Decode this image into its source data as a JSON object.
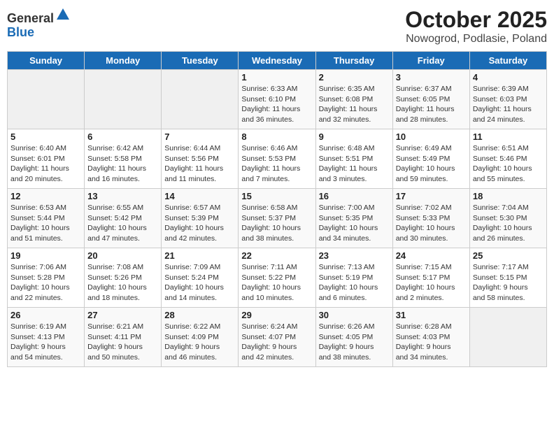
{
  "logo": {
    "general": "General",
    "blue": "Blue"
  },
  "title": {
    "month": "October 2025",
    "location": "Nowogrod, Podlasie, Poland"
  },
  "headers": [
    "Sunday",
    "Monday",
    "Tuesday",
    "Wednesday",
    "Thursday",
    "Friday",
    "Saturday"
  ],
  "weeks": [
    [
      {
        "day": "",
        "info": ""
      },
      {
        "day": "",
        "info": ""
      },
      {
        "day": "",
        "info": ""
      },
      {
        "day": "1",
        "info": "Sunrise: 6:33 AM\nSunset: 6:10 PM\nDaylight: 11 hours\nand 36 minutes."
      },
      {
        "day": "2",
        "info": "Sunrise: 6:35 AM\nSunset: 6:08 PM\nDaylight: 11 hours\nand 32 minutes."
      },
      {
        "day": "3",
        "info": "Sunrise: 6:37 AM\nSunset: 6:05 PM\nDaylight: 11 hours\nand 28 minutes."
      },
      {
        "day": "4",
        "info": "Sunrise: 6:39 AM\nSunset: 6:03 PM\nDaylight: 11 hours\nand 24 minutes."
      }
    ],
    [
      {
        "day": "5",
        "info": "Sunrise: 6:40 AM\nSunset: 6:01 PM\nDaylight: 11 hours\nand 20 minutes."
      },
      {
        "day": "6",
        "info": "Sunrise: 6:42 AM\nSunset: 5:58 PM\nDaylight: 11 hours\nand 16 minutes."
      },
      {
        "day": "7",
        "info": "Sunrise: 6:44 AM\nSunset: 5:56 PM\nDaylight: 11 hours\nand 11 minutes."
      },
      {
        "day": "8",
        "info": "Sunrise: 6:46 AM\nSunset: 5:53 PM\nDaylight: 11 hours\nand 7 minutes."
      },
      {
        "day": "9",
        "info": "Sunrise: 6:48 AM\nSunset: 5:51 PM\nDaylight: 11 hours\nand 3 minutes."
      },
      {
        "day": "10",
        "info": "Sunrise: 6:49 AM\nSunset: 5:49 PM\nDaylight: 10 hours\nand 59 minutes."
      },
      {
        "day": "11",
        "info": "Sunrise: 6:51 AM\nSunset: 5:46 PM\nDaylight: 10 hours\nand 55 minutes."
      }
    ],
    [
      {
        "day": "12",
        "info": "Sunrise: 6:53 AM\nSunset: 5:44 PM\nDaylight: 10 hours\nand 51 minutes."
      },
      {
        "day": "13",
        "info": "Sunrise: 6:55 AM\nSunset: 5:42 PM\nDaylight: 10 hours\nand 47 minutes."
      },
      {
        "day": "14",
        "info": "Sunrise: 6:57 AM\nSunset: 5:39 PM\nDaylight: 10 hours\nand 42 minutes."
      },
      {
        "day": "15",
        "info": "Sunrise: 6:58 AM\nSunset: 5:37 PM\nDaylight: 10 hours\nand 38 minutes."
      },
      {
        "day": "16",
        "info": "Sunrise: 7:00 AM\nSunset: 5:35 PM\nDaylight: 10 hours\nand 34 minutes."
      },
      {
        "day": "17",
        "info": "Sunrise: 7:02 AM\nSunset: 5:33 PM\nDaylight: 10 hours\nand 30 minutes."
      },
      {
        "day": "18",
        "info": "Sunrise: 7:04 AM\nSunset: 5:30 PM\nDaylight: 10 hours\nand 26 minutes."
      }
    ],
    [
      {
        "day": "19",
        "info": "Sunrise: 7:06 AM\nSunset: 5:28 PM\nDaylight: 10 hours\nand 22 minutes."
      },
      {
        "day": "20",
        "info": "Sunrise: 7:08 AM\nSunset: 5:26 PM\nDaylight: 10 hours\nand 18 minutes."
      },
      {
        "day": "21",
        "info": "Sunrise: 7:09 AM\nSunset: 5:24 PM\nDaylight: 10 hours\nand 14 minutes."
      },
      {
        "day": "22",
        "info": "Sunrise: 7:11 AM\nSunset: 5:22 PM\nDaylight: 10 hours\nand 10 minutes."
      },
      {
        "day": "23",
        "info": "Sunrise: 7:13 AM\nSunset: 5:19 PM\nDaylight: 10 hours\nand 6 minutes."
      },
      {
        "day": "24",
        "info": "Sunrise: 7:15 AM\nSunset: 5:17 PM\nDaylight: 10 hours\nand 2 minutes."
      },
      {
        "day": "25",
        "info": "Sunrise: 7:17 AM\nSunset: 5:15 PM\nDaylight: 9 hours\nand 58 minutes."
      }
    ],
    [
      {
        "day": "26",
        "info": "Sunrise: 6:19 AM\nSunset: 4:13 PM\nDaylight: 9 hours\nand 54 minutes."
      },
      {
        "day": "27",
        "info": "Sunrise: 6:21 AM\nSunset: 4:11 PM\nDaylight: 9 hours\nand 50 minutes."
      },
      {
        "day": "28",
        "info": "Sunrise: 6:22 AM\nSunset: 4:09 PM\nDaylight: 9 hours\nand 46 minutes."
      },
      {
        "day": "29",
        "info": "Sunrise: 6:24 AM\nSunset: 4:07 PM\nDaylight: 9 hours\nand 42 minutes."
      },
      {
        "day": "30",
        "info": "Sunrise: 6:26 AM\nSunset: 4:05 PM\nDaylight: 9 hours\nand 38 minutes."
      },
      {
        "day": "31",
        "info": "Sunrise: 6:28 AM\nSunset: 4:03 PM\nDaylight: 9 hours\nand 34 minutes."
      },
      {
        "day": "",
        "info": ""
      }
    ]
  ]
}
